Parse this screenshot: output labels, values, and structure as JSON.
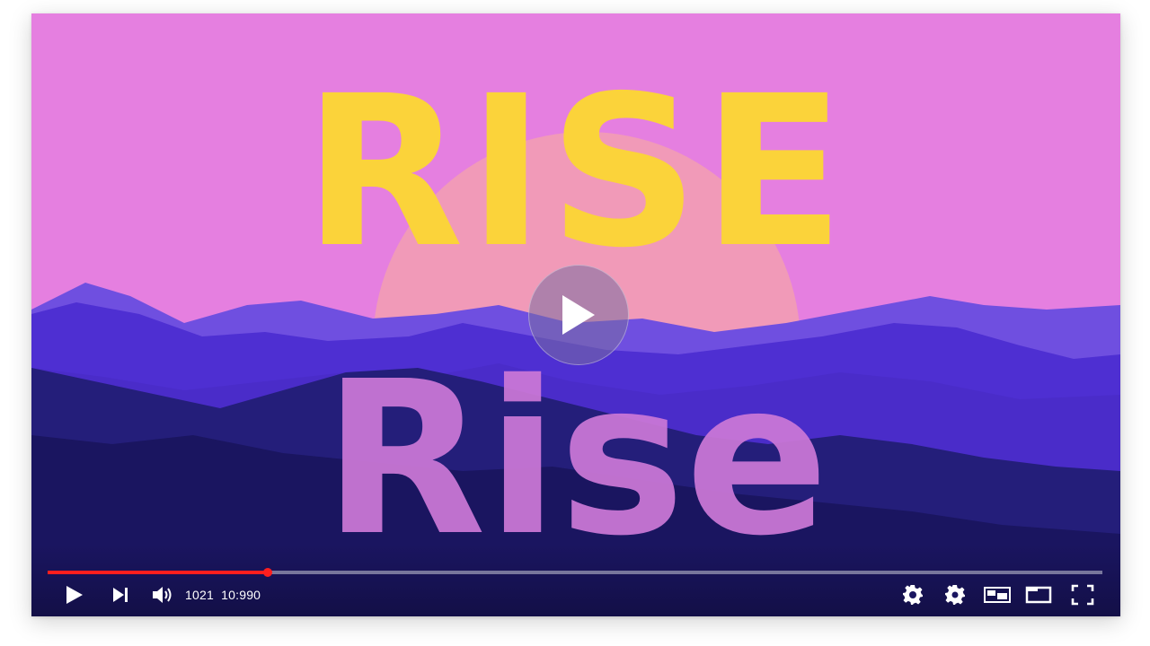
{
  "video": {
    "title_top": "RISE",
    "title_bottom": "Rise",
    "progress_fraction": 0.209,
    "buffer_fraction": 0.0
  },
  "controls": {
    "current_time": "1021",
    "duration": "10:990",
    "icons": [
      "play-icon",
      "next-icon",
      "volume-icon",
      "settings-gear-filled-icon",
      "settings-gear-icon",
      "miniplayer-icon",
      "theater-mode-icon",
      "fullscreen-icon"
    ]
  },
  "colors": {
    "sky": "#e57fe0",
    "sun": "#f19ab8",
    "title_top": "#fbd33a",
    "title_bottom": "#cd79d8",
    "mountain_far": "#6f4fe0",
    "mountain_mid": "#4e2fd2",
    "mountain_near": "#1f1a6e",
    "progress_played": "#ff1e1e"
  }
}
